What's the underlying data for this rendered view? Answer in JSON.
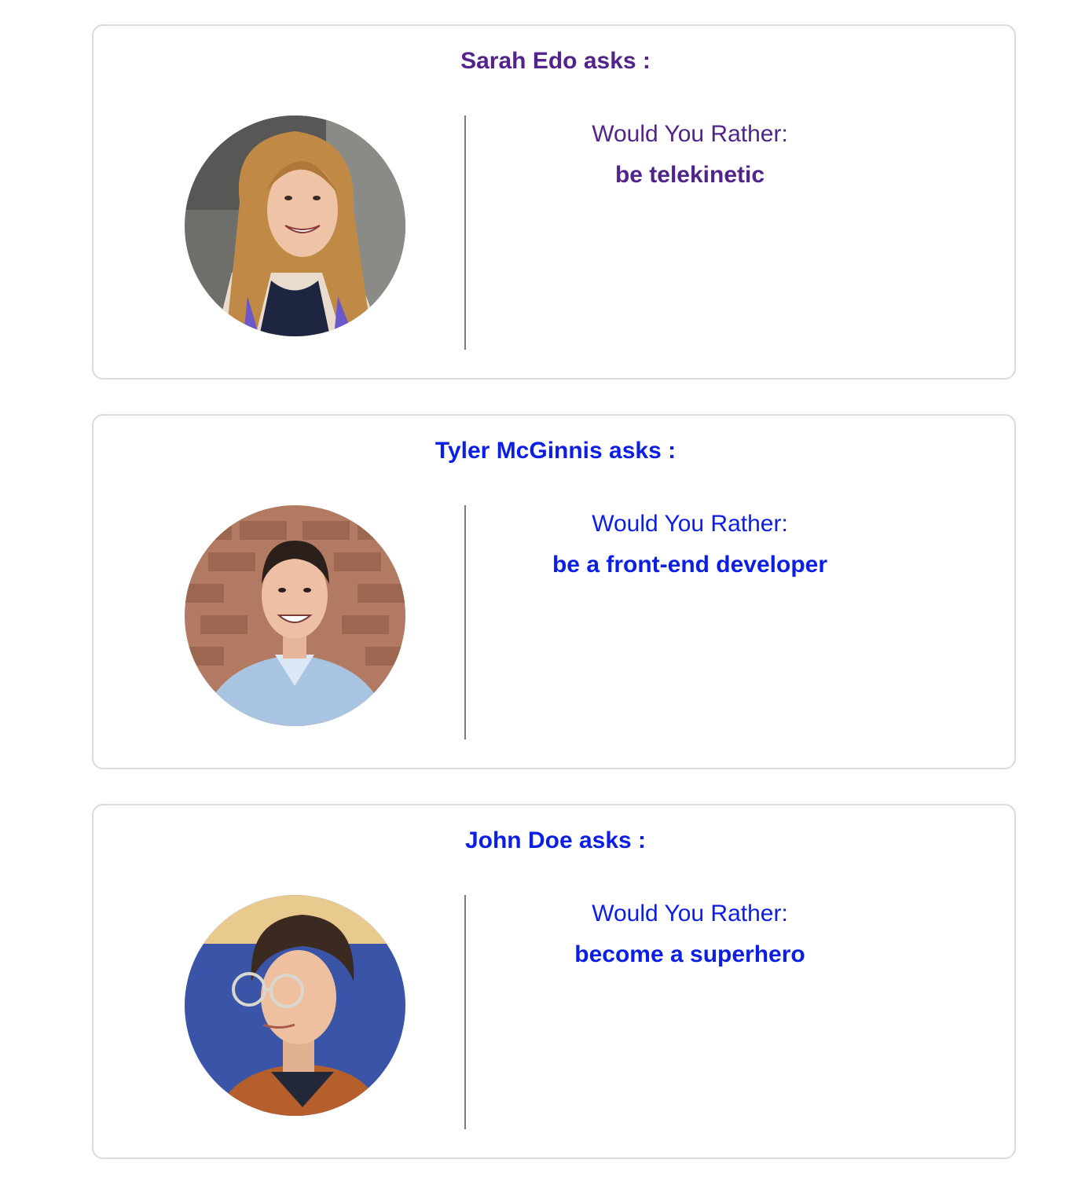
{
  "questions": [
    {
      "author": "Sarah Edo",
      "asker_text": "Sarah Edo asks :",
      "label": "Would You Rather:",
      "option": "be telekinetic",
      "link_state": "visited",
      "color": "#52238a"
    },
    {
      "author": "Tyler McGinnis",
      "asker_text": "Tyler McGinnis asks :",
      "label": "Would You Rather:",
      "option": "be a front-end developer",
      "link_state": "unvisited",
      "color": "#0b1ee6"
    },
    {
      "author": "John Doe",
      "asker_text": "John Doe asks :",
      "label": "Would You Rather:",
      "option": "become a superhero",
      "link_state": "unvisited",
      "color": "#0b1ee6"
    }
  ]
}
